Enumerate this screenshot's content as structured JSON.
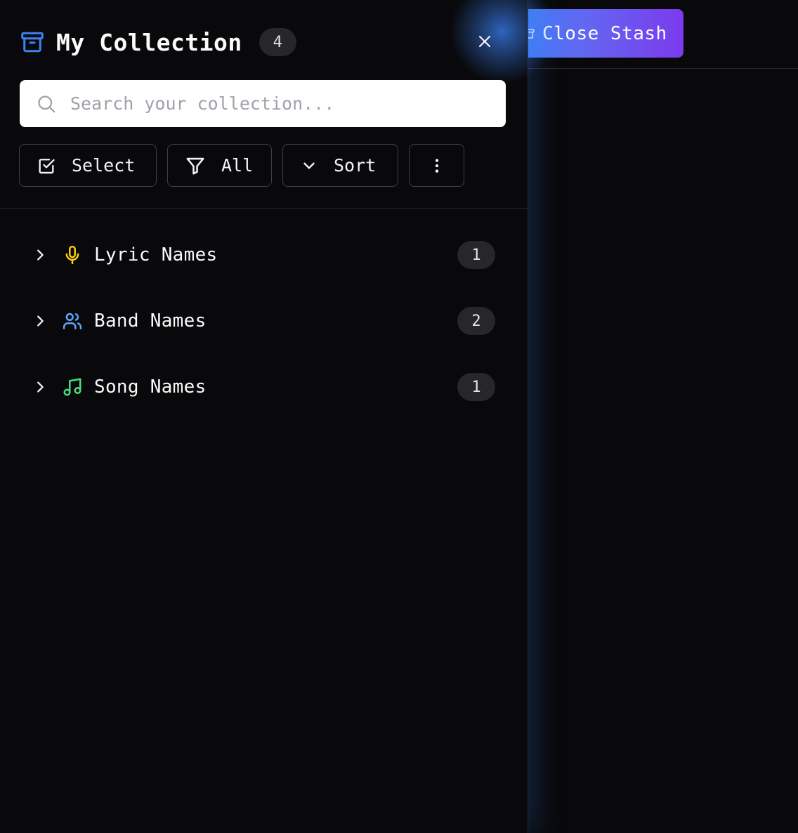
{
  "header": {
    "close_stash_label": "Close Stash"
  },
  "drawer": {
    "title": "My Collection",
    "item_count": "4",
    "search": {
      "placeholder": "Search your collection...",
      "value": ""
    },
    "toolbar": {
      "select_label": "Select",
      "filter_label": "All",
      "sort_label": "Sort"
    },
    "groups": [
      {
        "label": "Lyric Names",
        "count": "1",
        "icon": "microphone-icon",
        "color": "#facc15"
      },
      {
        "label": "Band Names",
        "count": "2",
        "icon": "users-icon",
        "color": "#60a5fa"
      },
      {
        "label": "Song Names",
        "count": "1",
        "icon": "music-note-icon",
        "color": "#4ade80"
      }
    ]
  },
  "colors": {
    "background": "#09090b",
    "accent_start": "#3b82f6",
    "accent_end": "#7c3aed",
    "badge_bg": "#27272a"
  }
}
